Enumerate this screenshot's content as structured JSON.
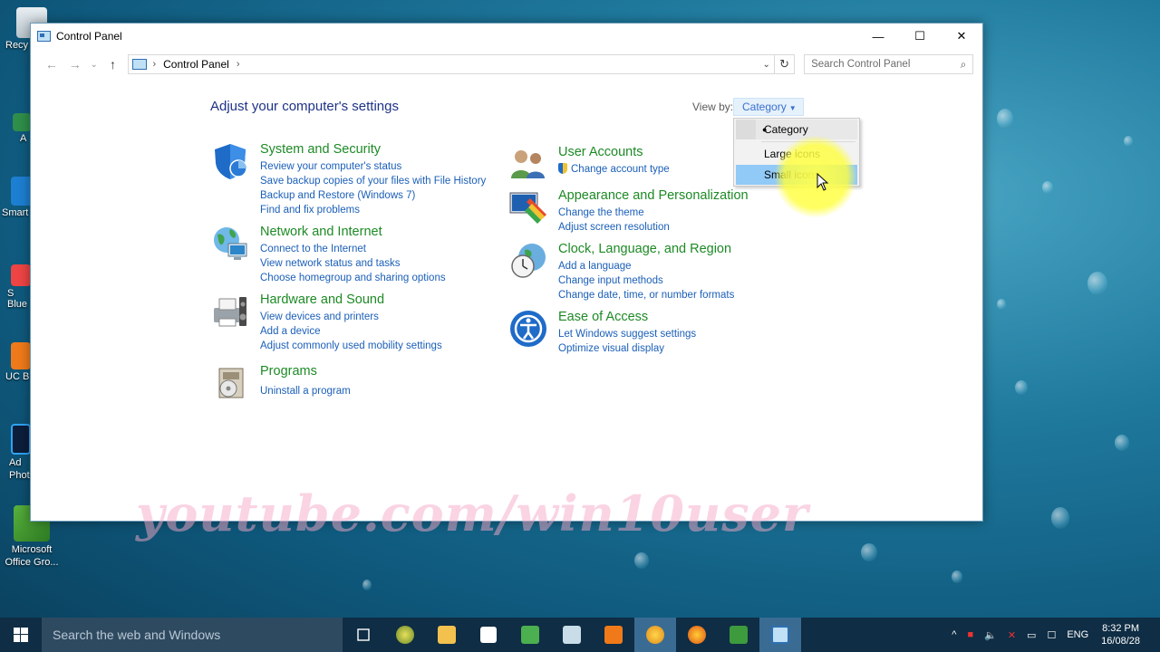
{
  "desktop": {
    "icons": [
      {
        "label": "Recy"
      },
      {
        "label": "A"
      },
      {
        "label": "Smart"
      },
      {
        "label": "S\nBlue"
      },
      {
        "label": "UC B"
      },
      {
        "label": "Ad\nPhot"
      },
      {
        "label": "Microsoft\nOffice Gro..."
      }
    ]
  },
  "window": {
    "title": "Control Panel",
    "buttons": {
      "minimize": "—",
      "maximize": "☐",
      "close": "✕"
    },
    "nav": {
      "back": "←",
      "forward": "→",
      "recent": "⌄",
      "up": "↑"
    },
    "address": {
      "crumb": "Control Panel",
      "sep1": "›",
      "sep2": "›",
      "dropdown": "⌄",
      "refresh": "↻"
    },
    "search": {
      "placeholder": "Search Control Panel",
      "icon": "⌕"
    },
    "heading": "Adjust your computer's settings",
    "view_by": {
      "label": "View by:",
      "value": "Category"
    },
    "dropdown": {
      "items": [
        {
          "label": "Category",
          "checked": true
        },
        {
          "label": "Large icons"
        },
        {
          "label": "Small icons",
          "hover": true
        }
      ]
    },
    "categories": [
      {
        "title": "System and Security",
        "icon": "shield-icon",
        "links": [
          "Review your computer's status",
          "Save backup copies of your files with File History",
          "Backup and Restore (Windows 7)",
          "Find and fix problems"
        ]
      },
      {
        "title": "Network and Internet",
        "icon": "network-icon",
        "links": [
          "Connect to the Internet",
          "View network status and tasks",
          "Choose homegroup and sharing options"
        ]
      },
      {
        "title": "Hardware and Sound",
        "icon": "printer-icon",
        "links": [
          "View devices and printers",
          "Add a device",
          "Adjust commonly used mobility settings"
        ]
      },
      {
        "title": "Programs",
        "icon": "programs-icon",
        "links": [
          "Uninstall a program"
        ]
      },
      {
        "title": "User Accounts",
        "icon": "users-icon",
        "links": [
          "Change account type"
        ]
      },
      {
        "title": "Appearance and Personalization",
        "icon": "monitor-icon",
        "links": [
          "Change the theme",
          "Adjust screen resolution"
        ]
      },
      {
        "title": "Clock, Language, and Region",
        "icon": "clock-icon",
        "links": [
          "Add a language",
          "Change input methods",
          "Change date, time, or number formats"
        ]
      },
      {
        "title": "Ease of Access",
        "icon": "accessibility-icon",
        "links": [
          "Let Windows suggest settings",
          "Optimize visual display"
        ]
      }
    ]
  },
  "watermark": "youtube.com/win10user",
  "taskbar": {
    "search_placeholder": "Search the web and Windows",
    "tray": {
      "chevron": "^",
      "lang": "ENG",
      "time": "8:32 PM",
      "date": "16/08/28"
    }
  }
}
